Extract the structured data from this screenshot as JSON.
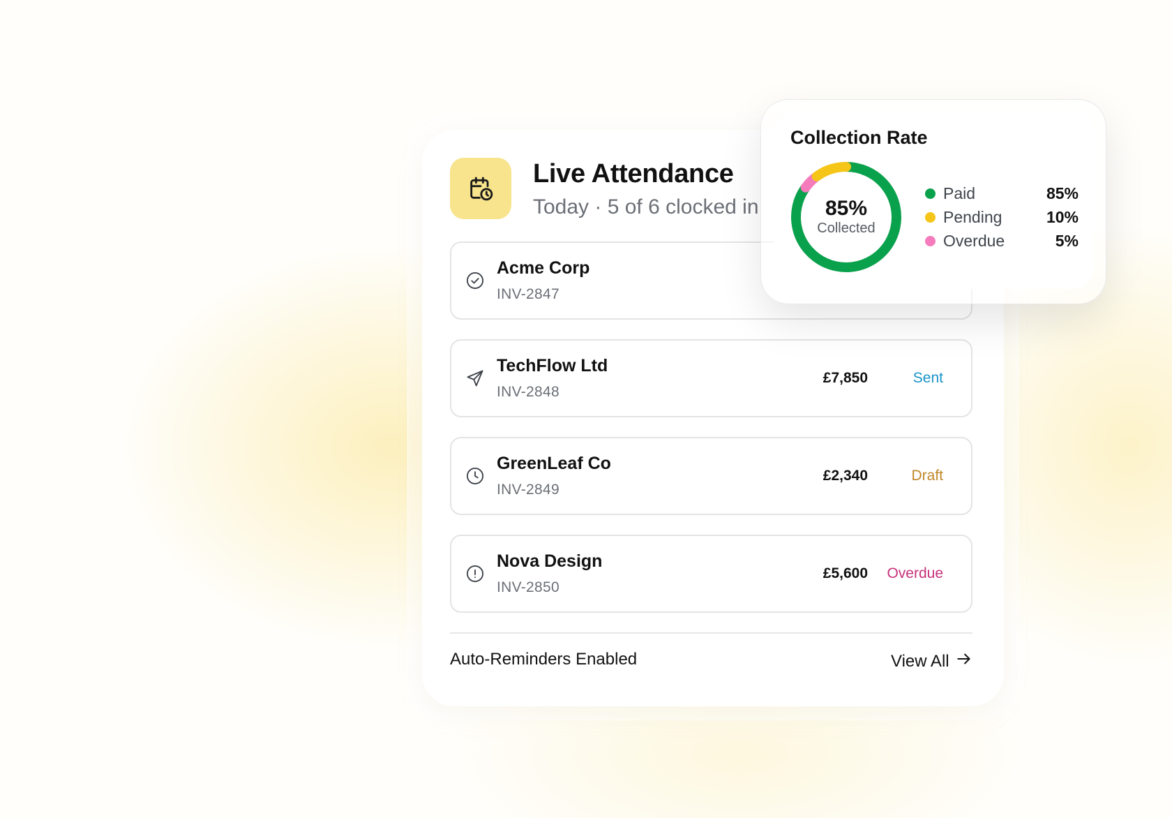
{
  "header": {
    "icon": "calendar-clock-icon",
    "title": "Live Attendance",
    "subtitle": "Today · 5 of 6 clocked in"
  },
  "invoices": [
    {
      "client": "Acme Corp",
      "invoice": "INV-2847",
      "icon": "check-circle-icon",
      "amount": "",
      "status": ""
    },
    {
      "client": "TechFlow Ltd",
      "invoice": "INV-2848",
      "icon": "send-icon",
      "amount": "£7,850",
      "status": "Sent"
    },
    {
      "client": "GreenLeaf Co",
      "invoice": "INV-2849",
      "icon": "clock-icon",
      "amount": "£2,340",
      "status": "Draft"
    },
    {
      "client": "Nova Design",
      "invoice": "INV-2850",
      "icon": "alert-circle-icon",
      "amount": "£5,600",
      "status": "Overdue"
    }
  ],
  "status_colors": {
    "Sent": "#1a94c9",
    "Draft": "#c0862a",
    "Overdue": "#c7317a"
  },
  "footer": {
    "left_label": "Auto-Reminders Enabled",
    "view_all_label": "View All"
  },
  "collection": {
    "title": "Collection Rate",
    "center_value": "85%",
    "center_label": "Collected",
    "legend": [
      {
        "name": "Paid",
        "value": "85%",
        "color": "#0aa14c"
      },
      {
        "name": "Pending",
        "value": "10%",
        "color": "#f5c518"
      },
      {
        "name": "Overdue",
        "value": "5%",
        "color": "#f57bbd"
      }
    ]
  },
  "chart_data": {
    "type": "pie",
    "title": "Collection Rate",
    "categories": [
      "Paid",
      "Pending",
      "Overdue"
    ],
    "values": [
      85,
      10,
      5
    ],
    "colors": [
      "#0aa14c",
      "#f5c518",
      "#f57bbd"
    ]
  }
}
